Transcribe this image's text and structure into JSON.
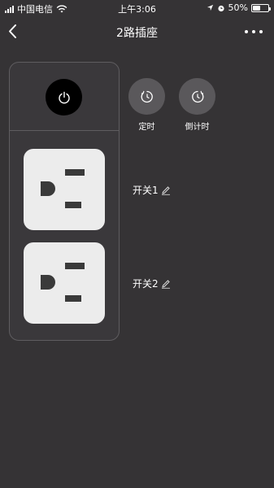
{
  "status_bar": {
    "carrier": "中国电信",
    "time": "上午3:06",
    "battery": "50%",
    "battery_level": 0.5,
    "icons": [
      "signal-icon",
      "wifi-icon",
      "location-icon",
      "alarm-icon",
      "battery-icon"
    ]
  },
  "nav": {
    "title": "2路插座",
    "back_icon": "chevron-left-icon",
    "more_icon": "more-dots-icon"
  },
  "strip": {
    "power_icon": "power-icon",
    "outlets": [
      {
        "label": "开关1",
        "edit_icon": "pencil-icon"
      },
      {
        "label": "开关2",
        "edit_icon": "pencil-icon"
      }
    ]
  },
  "actions": [
    {
      "label": "定时",
      "icon": "timer-icon"
    },
    {
      "label": "倒计时",
      "icon": "countdown-icon"
    }
  ],
  "colors": {
    "background": "#353335",
    "panel": "#3a383b",
    "panel_border": "#5f5d60",
    "action_circle": "#5a585b",
    "outlet_face": "#ececec",
    "power_button": "#000000"
  }
}
